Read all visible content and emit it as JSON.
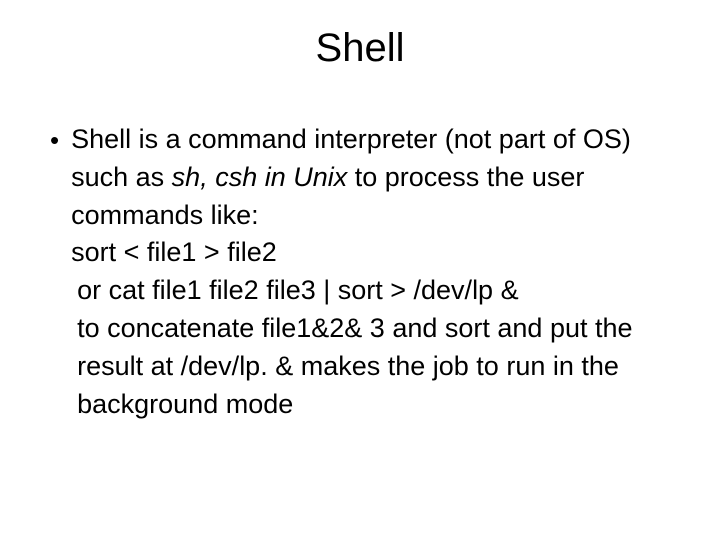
{
  "title": "Shell",
  "bullet": "•",
  "lines": {
    "l1a": "Shell is a command interpreter (not part of OS) such as ",
    "l1b": "sh, csh in Unix",
    "l1c": " to process the user commands like:",
    "l2": "sort < file1 > file2",
    "l3": " or cat file1 file2 file3 | sort > /dev/lp &",
    "l4": " to concatenate file1&2& 3 and sort and put the result at /dev/lp. & makes the job to run in the background mode"
  }
}
